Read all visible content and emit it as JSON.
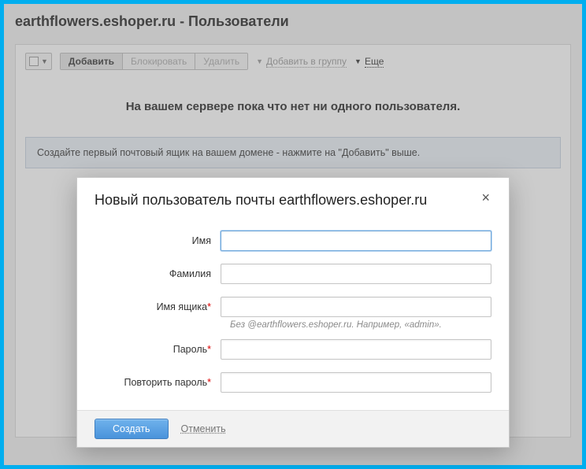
{
  "page": {
    "title": "earthflowers.eshoper.ru - Пользователи"
  },
  "toolbar": {
    "add": "Добавить",
    "block": "Блокировать",
    "delete": "Удалить",
    "addToGroup": "Добавить в группу",
    "more": "Еще"
  },
  "emptyMessage": "На вашем сервере пока что нет ни одного пользователя.",
  "hintBox": "Создайте первый почтовый ящик на вашем домене - нажмите на \"Добавить\" выше.",
  "modal": {
    "title": "Новый пользователь почты earthflowers.eshoper.ru",
    "fields": {
      "firstName": "Имя",
      "lastName": "Фамилия",
      "mailbox": "Имя ящика",
      "mailboxHint": "Без @earthflowers.eshoper.ru. Например, «admin».",
      "password": "Пароль",
      "passwordRepeat": "Повторить пароль"
    },
    "actions": {
      "create": "Создать",
      "cancel": "Отменить"
    }
  }
}
